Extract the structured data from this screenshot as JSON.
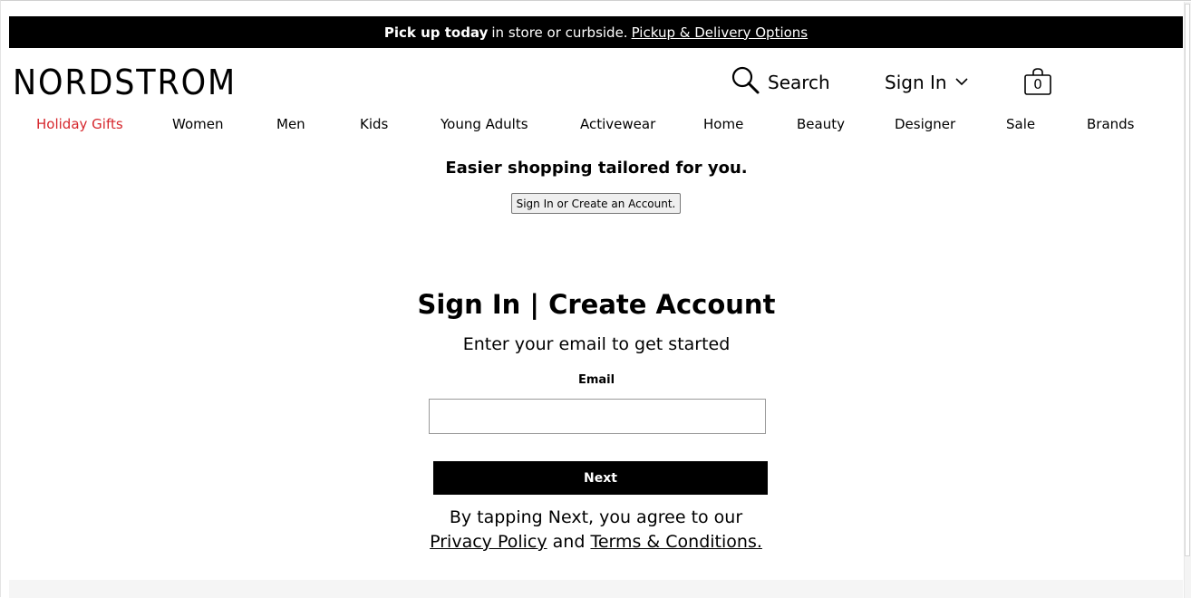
{
  "promo": {
    "bold_text": "Pick up today",
    "plain_text": "in store or curbside.",
    "link_text": "Pickup & Delivery Options"
  },
  "header": {
    "logo_text": "NORDSTROM",
    "search_label": "Search",
    "signin_label": "Sign In",
    "bag_count": "0"
  },
  "nav": {
    "items": [
      "Holiday Gifts",
      "Women",
      "Men",
      "Kids",
      "Young Adults",
      "Activewear",
      "Home",
      "Beauty",
      "Designer",
      "Sale",
      "Brands"
    ],
    "highlight_color": "#d6262c"
  },
  "tailored": {
    "heading": "Easier shopping tailored for you.",
    "button_label": "Sign In or Create an Account."
  },
  "signin": {
    "title": "Sign In | Create Account",
    "subtitle": "Enter your email to get started",
    "email_label": "Email",
    "email_value": "",
    "next_label": "Next",
    "terms_prefix": "By tapping Next, you agree to our",
    "privacy_link": "Privacy Policy",
    "terms_and": "and",
    "terms_link": "Terms & Conditions."
  },
  "icons": {
    "search": "search-icon",
    "chevron": "chevron-down-icon",
    "bag": "shopping-bag-icon"
  }
}
